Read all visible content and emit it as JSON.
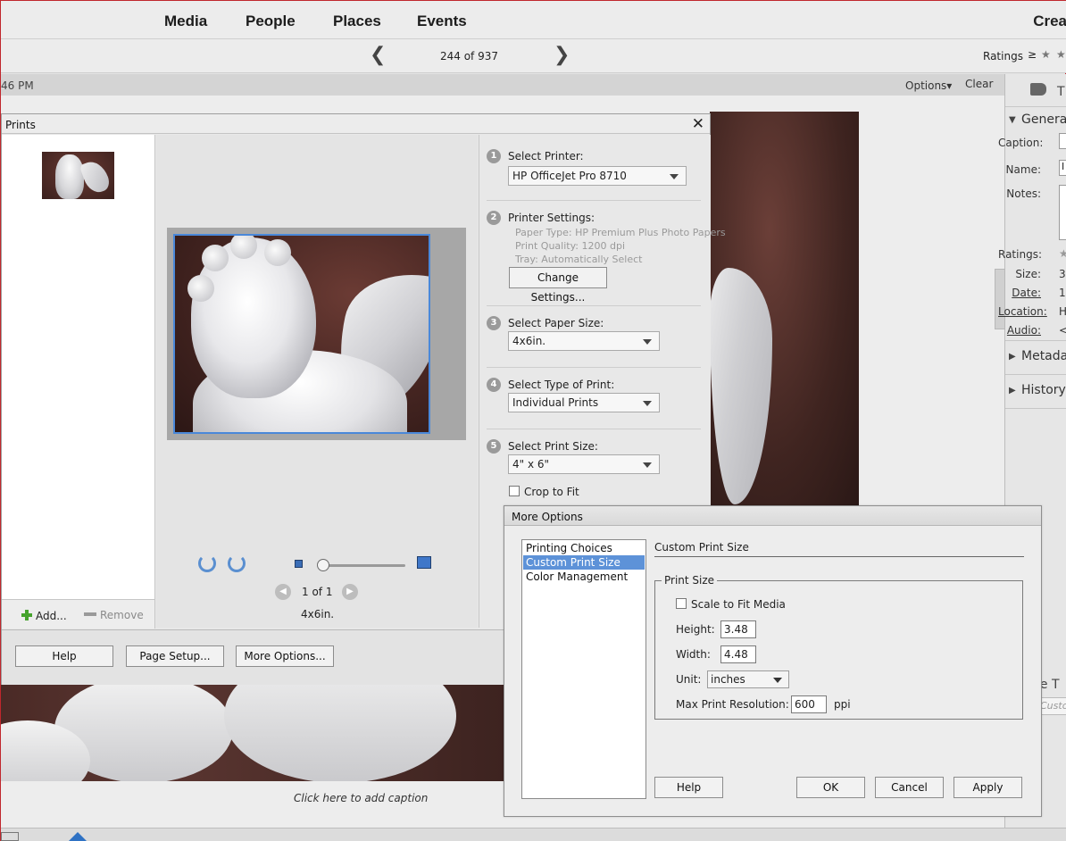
{
  "nav": {
    "tabs": [
      "Media",
      "People",
      "Places",
      "Events"
    ],
    "create_label": "Crea"
  },
  "pager": {
    "count_text": "244 of 937",
    "prev_glyph": "❮",
    "next_glyph": "❯"
  },
  "ratings": {
    "label": "Ratings",
    "ge_symbol": "≥",
    "star_glyph": "★"
  },
  "greybar": {
    "time_text": "46 PM",
    "options_label": "Options▾",
    "clear_label": "Clear"
  },
  "caption_hint": "Click here to add caption",
  "right_panel": {
    "tab_title": "T",
    "general_label": "General",
    "metadata_label": "Metada",
    "history_label": "History",
    "collapsed_glyph": "▶",
    "expanded_glyph": "▼",
    "caption_label": "Caption:",
    "name_label": "Name:",
    "name_value": "I",
    "notes_label": "Notes:",
    "ratings_label": "Ratings:",
    "ratings_value": "★",
    "size_label": "Size:",
    "size_value": "3",
    "date_label": "Date:",
    "date_value": "1",
    "location_label": "Location:",
    "location_value": "H",
    "audio_label": "Audio:",
    "audio_value": "<",
    "page_text": "ge T",
    "custom_placeholder": "Custo"
  },
  "prints": {
    "title": "Prints",
    "close_glyph": "✕",
    "add_label": "Add...",
    "remove_label": "Remove",
    "page_prev_glyph": "◀",
    "page_next_glyph": "▶",
    "page_of": "1 of 1",
    "size_label": "4x6in.",
    "steps": [
      {
        "num": "1",
        "title": "Select Printer:",
        "value": "HP OfficeJet Pro 8710"
      },
      {
        "num": "2",
        "title": "Printer Settings:"
      },
      {
        "num": "3",
        "title": "Select Paper Size:",
        "value": "4x6in."
      },
      {
        "num": "4",
        "title": "Select Type of Print:",
        "value": "Individual Prints"
      },
      {
        "num": "5",
        "title": "Select Print Size:",
        "value": "4\" x 6\""
      }
    ],
    "printer_info": {
      "paper_type": "Paper Type: HP Premium Plus Photo Papers",
      "print_quality": "Print Quality: 1200 dpi",
      "tray": "Tray: Automatically Select"
    },
    "change_settings_label": "Change Settings...",
    "crop_to_fit_label": "Crop to Fit",
    "help_label": "Help",
    "page_setup_label": "Page Setup...",
    "more_options_label": "More Options..."
  },
  "more_options": {
    "title": "More Options",
    "list_items": [
      "Printing Choices",
      "Custom Print Size",
      "Color Management"
    ],
    "section_title": "Custom Print Size",
    "group_label": "Print Size",
    "scale_label": "Scale to Fit Media",
    "height_label": "Height:",
    "height_value": "3.48",
    "width_label": "Width:",
    "width_value": "4.48",
    "unit_label": "Unit:",
    "unit_value": "inches",
    "max_res_label": "Max Print Resolution:",
    "max_res_value": "600",
    "ppi_label": "ppi",
    "help_label": "Help",
    "ok_label": "OK",
    "cancel_label": "Cancel",
    "apply_label": "Apply"
  }
}
